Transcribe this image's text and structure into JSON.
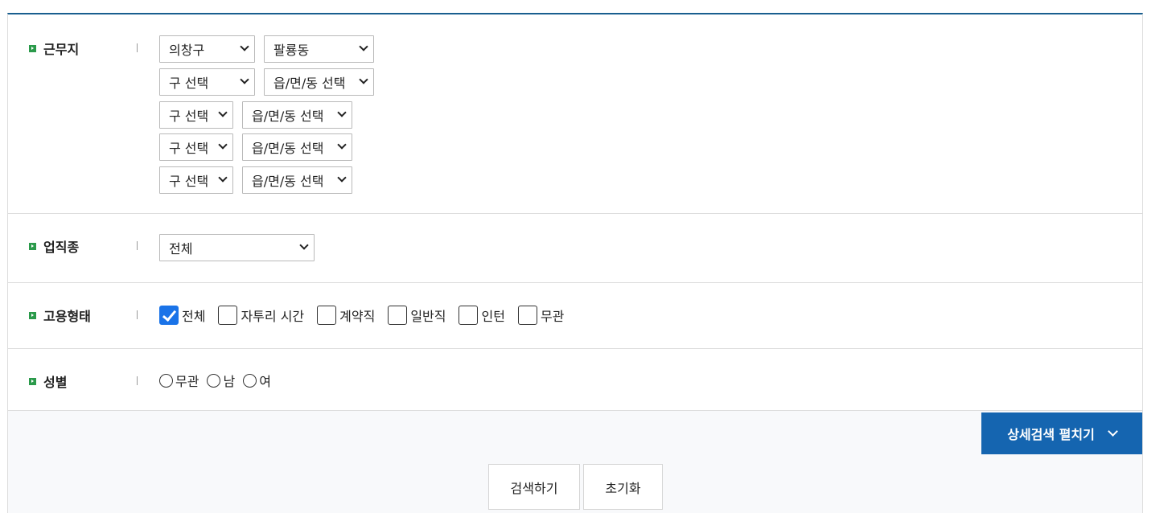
{
  "work_location": {
    "label": "근무지",
    "rows": [
      {
        "district": "의창구",
        "town": "팔룡동"
      },
      {
        "district": "구 선택",
        "town": "읍/면/동 선택"
      },
      {
        "district": "구 선택",
        "town": "읍/면/동 선택"
      },
      {
        "district": "구 선택",
        "town": "읍/면/동 선택"
      },
      {
        "district": "구 선택",
        "town": "읍/면/동 선택"
      }
    ]
  },
  "job_type": {
    "label": "업직종",
    "value": "전체"
  },
  "employment": {
    "label": "고용형태",
    "options": [
      {
        "label": "전체",
        "checked": true
      },
      {
        "label": "자투리 시간",
        "checked": false
      },
      {
        "label": "계약직",
        "checked": false
      },
      {
        "label": "일반직",
        "checked": false
      },
      {
        "label": "인턴",
        "checked": false
      },
      {
        "label": "무관",
        "checked": false
      }
    ]
  },
  "gender": {
    "label": "성별",
    "options": [
      "무관",
      "남",
      "여"
    ]
  },
  "actions": {
    "expand_label": "상세검색 펼치기",
    "search_label": "검색하기",
    "reset_label": "초기화"
  },
  "colors": {
    "accent": "#1565b0",
    "bullet": "#2b9a4b",
    "checkbox_on": "#1a73e8",
    "top_border": "#1a5f8f"
  },
  "icons": {
    "bullet": "green-square-arrow-icon",
    "select_arrow": "chevron-down-icon",
    "expand_arrow": "chevron-down-icon"
  }
}
